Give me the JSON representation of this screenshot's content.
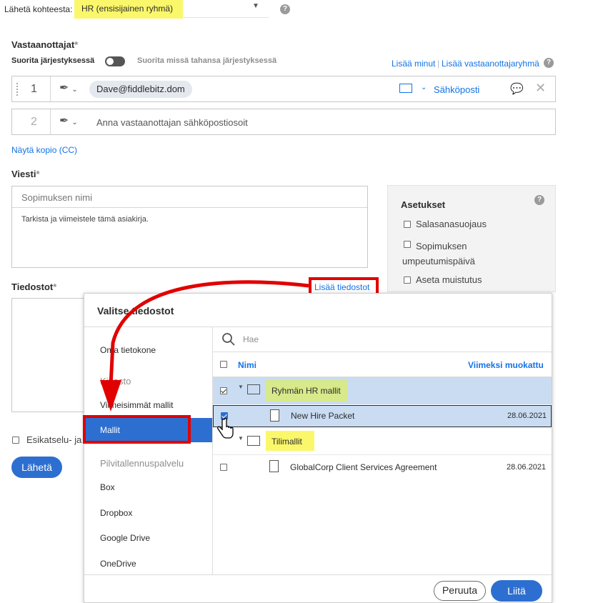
{
  "send_from": {
    "label": "Lähetä kohteesta:",
    "value": "HR (ensisijainen ryhmä)"
  },
  "recipients": {
    "title": "Vastaanottajat",
    "required_mark": "*",
    "order_label": "Suorita järjestyksessä",
    "any_order_label": "Suorita missä tahansa järjestyksessä",
    "add_me": "Lisää minut",
    "add_group": "Lisää vastaanottajaryhmä",
    "rows": [
      {
        "number": "1",
        "email": "Dave@fiddlebitz.dom",
        "method": "Sähköposti"
      },
      {
        "number": "2",
        "placeholder": "Anna vastaanottajan sähköpostiosoit"
      }
    ],
    "show_cc": "Näytä kopio (CC)"
  },
  "message": {
    "title": "Viesti",
    "required_mark": "*",
    "agreement_name_placeholder": "Sopimuksen nimi",
    "body": "Tarkista ja viimeistele tämä asiakirja."
  },
  "settings": {
    "title": "Asetukset",
    "options": [
      "Salasanasuojaus",
      "Sopimuksen umpeutumispäivä",
      "Aseta muistutus"
    ]
  },
  "files": {
    "title": "Tiedostot",
    "required_mark": "*",
    "add_files": "Lisää tiedostot"
  },
  "preview_label": "Esikatselu- ja Li",
  "send_button": "Lähetä",
  "dialog": {
    "title": "Valitse tiedostot",
    "search_placeholder": "Hae",
    "nav": [
      {
        "label": "Oma tietokone",
        "section": false
      },
      {
        "label": "Kirjasto",
        "section": true
      },
      {
        "label": "Viimeisimmät mallit",
        "section": false
      },
      {
        "label": "Mallit",
        "section": false,
        "selected": true
      },
      {
        "label": "Pilvitallennuspalvelu",
        "section": true
      },
      {
        "label": "Box",
        "section": false
      },
      {
        "label": "Dropbox",
        "section": false
      },
      {
        "label": "Google Drive",
        "section": false
      },
      {
        "label": "OneDrive",
        "section": false
      }
    ],
    "columns": {
      "name": "Nimi",
      "modified": "Viimeksi muokattu"
    },
    "rows": [
      {
        "type": "folder",
        "name": "Ryhmän HR mallit",
        "date": "",
        "checked": true
      },
      {
        "type": "file",
        "name": "New Hire Packet",
        "date": "28.06.2021",
        "checked": true
      },
      {
        "type": "folder",
        "name": "Tilimallit",
        "date": "",
        "checked": false
      },
      {
        "type": "file",
        "name": "GlobalCorp Client Services Agreement",
        "date": "28.06.2021",
        "checked": false
      }
    ],
    "cancel": "Peruuta",
    "attach": "Liitä"
  },
  "colors": {
    "accent": "#2d6fd1",
    "annotation": "#e10000",
    "highlight_yellow": "#fbf76b",
    "highlight_green": "#d7e98a"
  }
}
